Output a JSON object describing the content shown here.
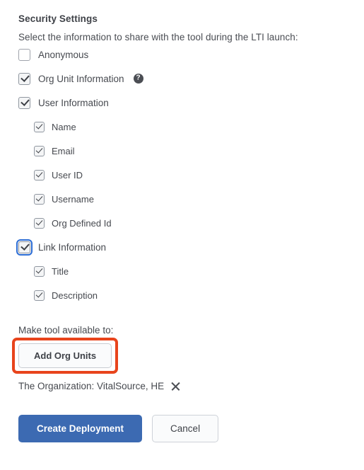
{
  "section": {
    "title": "Security Settings",
    "description": "Select the information to share with the tool during the LTI launch:"
  },
  "permissions": [
    {
      "label": "Anonymous",
      "checked": false,
      "level": 1,
      "help": false,
      "focused": false
    },
    {
      "label": "Org Unit Information",
      "checked": true,
      "level": 1,
      "help": true,
      "focused": false
    },
    {
      "label": "User Information",
      "checked": true,
      "level": 1,
      "help": false,
      "focused": false
    },
    {
      "label": "Name",
      "checked": true,
      "level": 2,
      "help": false,
      "focused": false
    },
    {
      "label": "Email",
      "checked": true,
      "level": 2,
      "help": false,
      "focused": false
    },
    {
      "label": "User ID",
      "checked": true,
      "level": 2,
      "help": false,
      "focused": false
    },
    {
      "label": "Username",
      "checked": true,
      "level": 2,
      "help": false,
      "focused": false
    },
    {
      "label": "Org Defined Id",
      "checked": true,
      "level": 2,
      "help": false,
      "focused": false
    },
    {
      "label": "Link Information",
      "checked": true,
      "level": 1,
      "help": false,
      "focused": true
    },
    {
      "label": "Title",
      "checked": true,
      "level": 2,
      "help": false,
      "focused": false
    },
    {
      "label": "Description",
      "checked": true,
      "level": 2,
      "help": false,
      "focused": false
    }
  ],
  "help_icon_glyph": "?",
  "availability": {
    "label": "Make tool available to:",
    "add_button_label": "Add Org Units",
    "selected_org": "The Organization: VitalSource, HE",
    "remove_icon_name": "close-icon"
  },
  "footer": {
    "primary_label": "Create Deployment",
    "cancel_label": "Cancel"
  },
  "colors": {
    "primary_button": "#3c6ab2",
    "annotation": "#e8441c",
    "focus_ring": "#2b6cd4",
    "text": "#46494f"
  }
}
